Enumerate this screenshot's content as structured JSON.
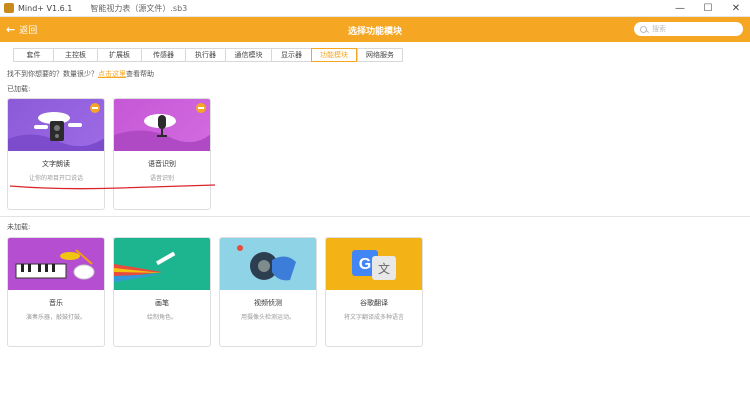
{
  "window": {
    "app_title": "Mind+ V1.6.1",
    "file_title": "智能视力表（源文件）.sb3",
    "minimize": "—",
    "maximize": "☐",
    "close": "✕"
  },
  "header": {
    "back_label": "返回",
    "title": "选择功能模块",
    "search_placeholder": "搜索"
  },
  "tabs": [
    {
      "label": "套件"
    },
    {
      "label": "主控板"
    },
    {
      "label": "扩展板"
    },
    {
      "label": "传感器"
    },
    {
      "label": "执行器"
    },
    {
      "label": "通信模块"
    },
    {
      "label": "显示器"
    },
    {
      "label": "功能模块",
      "active": true
    },
    {
      "label": "网络服务"
    }
  ],
  "help": {
    "prefix": "找不到你想要的？数量很少？",
    "link": "点击这里",
    "suffix": "查看帮助"
  },
  "loaded": {
    "label": "已加载:",
    "cards": [
      {
        "name": "文字朗读",
        "desc": "让你的项目开口说话"
      },
      {
        "name": "语音识别",
        "desc": "语音识别"
      }
    ]
  },
  "unloaded": {
    "label": "未加载:",
    "cards": [
      {
        "name": "音乐",
        "desc": "演奏乐器，敲鼓打鼓。"
      },
      {
        "name": "画笔",
        "desc": "绘制角色。"
      },
      {
        "name": "视频侦测",
        "desc": "用摄像头检测运动。"
      },
      {
        "name": "谷歌翻译",
        "desc": "将文字翻译成多种语言"
      }
    ]
  },
  "colors": {
    "accent": "#f5a623",
    "annotation": "#d9262c"
  }
}
